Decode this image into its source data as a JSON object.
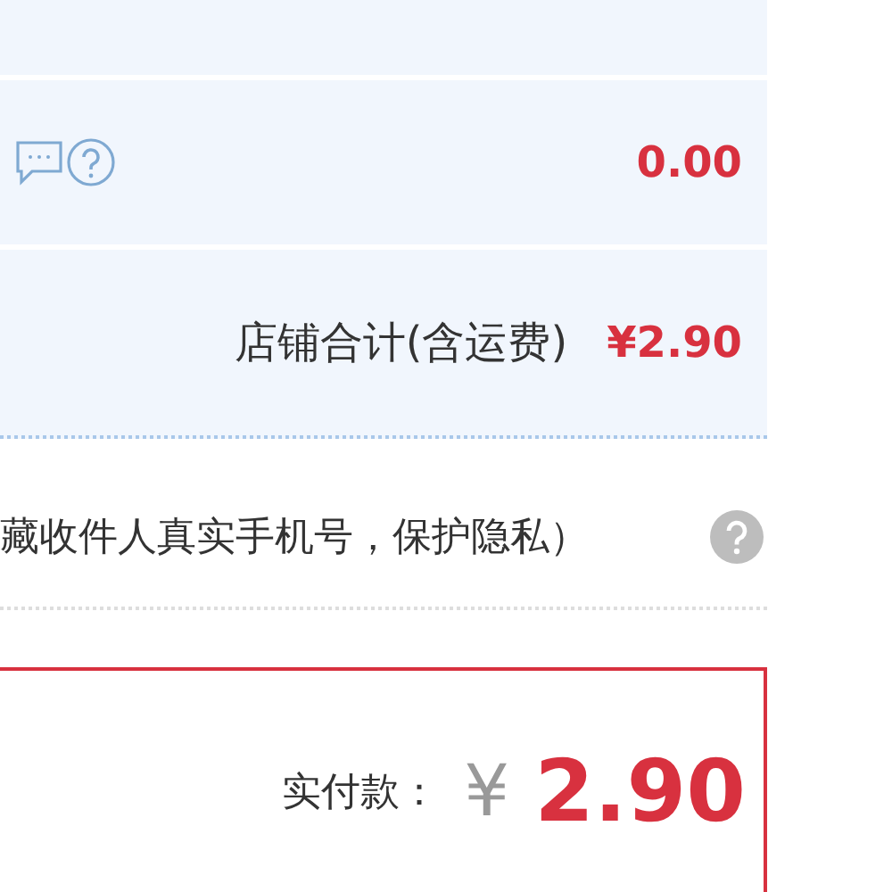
{
  "fee_row": {
    "amount": "0.00"
  },
  "shop_total": {
    "label": "店铺合计(含运费)",
    "amount": "¥2.90"
  },
  "privacy_row": {
    "text": "藏收件人真实手机号，保护隐私）"
  },
  "payment": {
    "label": "实付款：",
    "currency": "¥",
    "amount": "2.90"
  }
}
